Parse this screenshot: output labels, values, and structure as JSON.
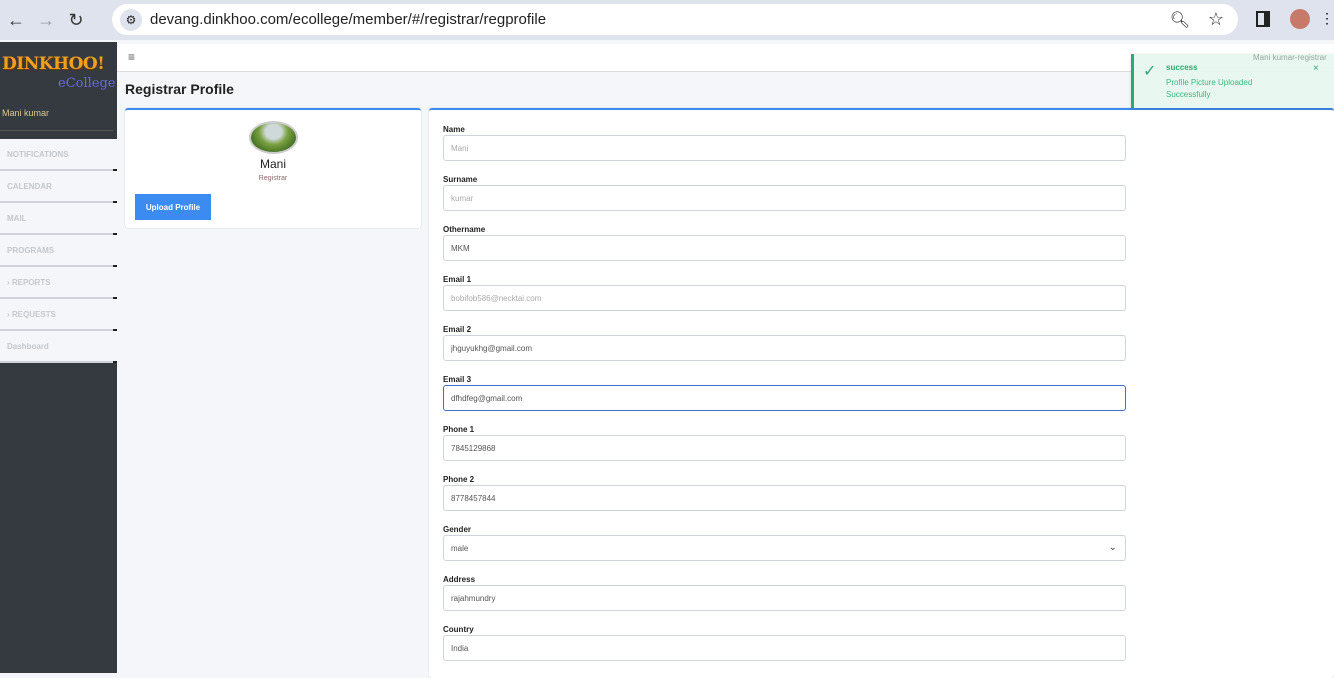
{
  "browser": {
    "url": "devang.dinkhoo.com/ecollege/member/#/registrar/regprofile",
    "back": "←",
    "forward": "→",
    "reload": "↻"
  },
  "sidebar": {
    "logo": "DINKHOO!",
    "logo_sub": "eCollege",
    "user": "Mani kumar",
    "items": [
      {
        "label": "NOTIFICATIONS"
      },
      {
        "label": "CALENDAR"
      },
      {
        "label": "MAIL"
      },
      {
        "label": "PROGRAMS"
      },
      {
        "label": "› REPORTS"
      },
      {
        "label": "› REQUESTS"
      },
      {
        "label": "Dashboard"
      }
    ]
  },
  "topbar": {
    "menu": "≡",
    "user": "Mani kumar-registrar"
  },
  "page": {
    "title": "Registrar Profile"
  },
  "profile": {
    "name": "Mani",
    "role": "Registrar",
    "upload_label": "Upload Profile"
  },
  "form": {
    "fields": [
      {
        "label": "Name",
        "value": "Mani"
      },
      {
        "label": "Surname",
        "value": "kumar"
      },
      {
        "label": "Othername",
        "value": "MKM"
      },
      {
        "label": "Email 1",
        "value": "bobifob586@necktai.com"
      },
      {
        "label": "Email 2",
        "value": "jhguyukhg@gmail.com"
      },
      {
        "label": "Email 3",
        "value": "dfhdfeg@gmail.com"
      },
      {
        "label": "Phone 1",
        "value": "7845129868"
      },
      {
        "label": "Phone 2",
        "value": "8778457844"
      },
      {
        "label": "Gender",
        "value": "male"
      },
      {
        "label": "Address",
        "value": "rajahmundry"
      },
      {
        "label": "Country",
        "value": "India"
      }
    ]
  },
  "toast": {
    "title": "success",
    "message": "Profile Picture Uploaded Successfully",
    "close": "×",
    "color": "#2eaa70"
  }
}
